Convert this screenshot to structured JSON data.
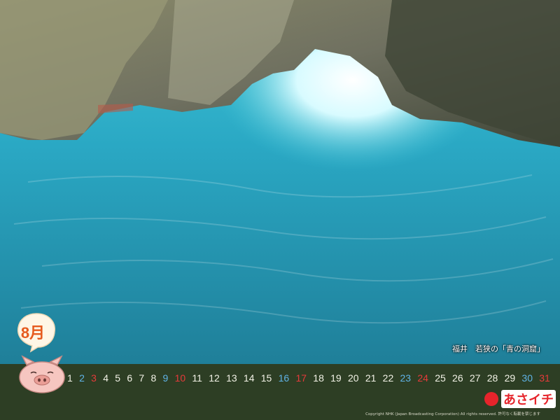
{
  "month": "8月",
  "caption": "福井　若狭の「青の洞窟」",
  "days": [
    {
      "n": "1",
      "t": "wk"
    },
    {
      "n": "2",
      "t": "sat"
    },
    {
      "n": "3",
      "t": "sun"
    },
    {
      "n": "4",
      "t": "wk"
    },
    {
      "n": "5",
      "t": "wk"
    },
    {
      "n": "6",
      "t": "wk"
    },
    {
      "n": "7",
      "t": "wk"
    },
    {
      "n": "8",
      "t": "wk"
    },
    {
      "n": "9",
      "t": "sat"
    },
    {
      "n": "10",
      "t": "sun"
    },
    {
      "n": "11",
      "t": "wk"
    },
    {
      "n": "12",
      "t": "wk"
    },
    {
      "n": "13",
      "t": "wk"
    },
    {
      "n": "14",
      "t": "wk"
    },
    {
      "n": "15",
      "t": "wk"
    },
    {
      "n": "16",
      "t": "sat"
    },
    {
      "n": "17",
      "t": "sun"
    },
    {
      "n": "18",
      "t": "wk"
    },
    {
      "n": "19",
      "t": "wk"
    },
    {
      "n": "20",
      "t": "wk"
    },
    {
      "n": "21",
      "t": "wk"
    },
    {
      "n": "22",
      "t": "wk"
    },
    {
      "n": "23",
      "t": "sat"
    },
    {
      "n": "24",
      "t": "sun"
    },
    {
      "n": "25",
      "t": "wk"
    },
    {
      "n": "26",
      "t": "wk"
    },
    {
      "n": "27",
      "t": "wk"
    },
    {
      "n": "28",
      "t": "wk"
    },
    {
      "n": "29",
      "t": "wk"
    },
    {
      "n": "30",
      "t": "sat"
    },
    {
      "n": "31",
      "t": "sun"
    }
  ],
  "logo": "あさイチ",
  "copyright": "Copyright NHK (Japan Broadcasting Corporation) All rights reserved.  許可なく転載を禁じます",
  "colors": {
    "bar": "#2d3e24",
    "saturday": "#5fb3e6",
    "sunday": "#e63a3a",
    "weekday": "#f2f2e6",
    "water": "#2aa8c4"
  }
}
